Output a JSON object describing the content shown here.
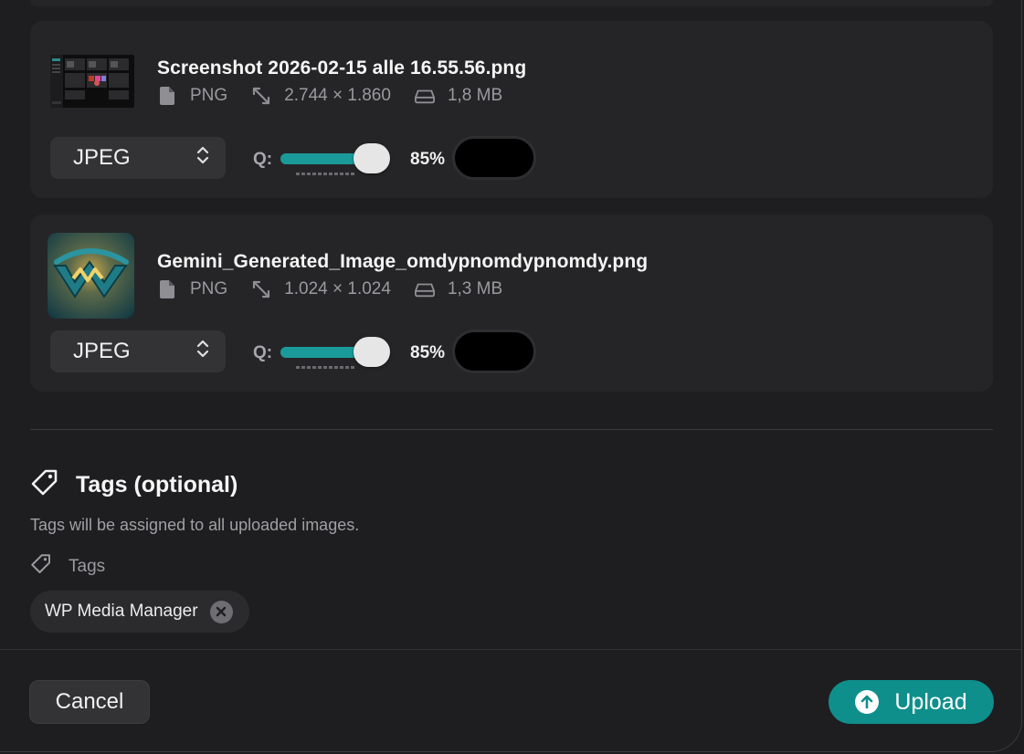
{
  "files": [
    {
      "name": "Screenshot 2026-02-15 alle 16.55.56.png",
      "type": "PNG",
      "dimensions": "2.744 × 1.860",
      "size": "1,8 MB",
      "format": "JPEG",
      "quality_label": "Q:",
      "quality": 85,
      "quality_text": "85%"
    },
    {
      "name": "Gemini_Generated_Image_omdypnomdypnomdy.png",
      "type": "PNG",
      "dimensions": "1.024 × 1.024",
      "size": "1,3 MB",
      "format": "JPEG",
      "quality_label": "Q:",
      "quality": 85,
      "quality_text": "85%"
    }
  ],
  "tags": {
    "title": "Tags (optional)",
    "description": "Tags will be assigned to all uploaded images.",
    "field_label": "Tags",
    "chips": [
      "WP Media Manager"
    ]
  },
  "footer": {
    "cancel_label": "Cancel",
    "upload_label": "Upload"
  },
  "colors": {
    "accent": "#0f8f8c",
    "slider_fill": "#1a9b9a"
  },
  "icons": [
    "file-icon",
    "resize-icon",
    "drive-icon",
    "chevron-updown-icon",
    "tag-icon",
    "close-icon",
    "arrow-up-icon"
  ]
}
